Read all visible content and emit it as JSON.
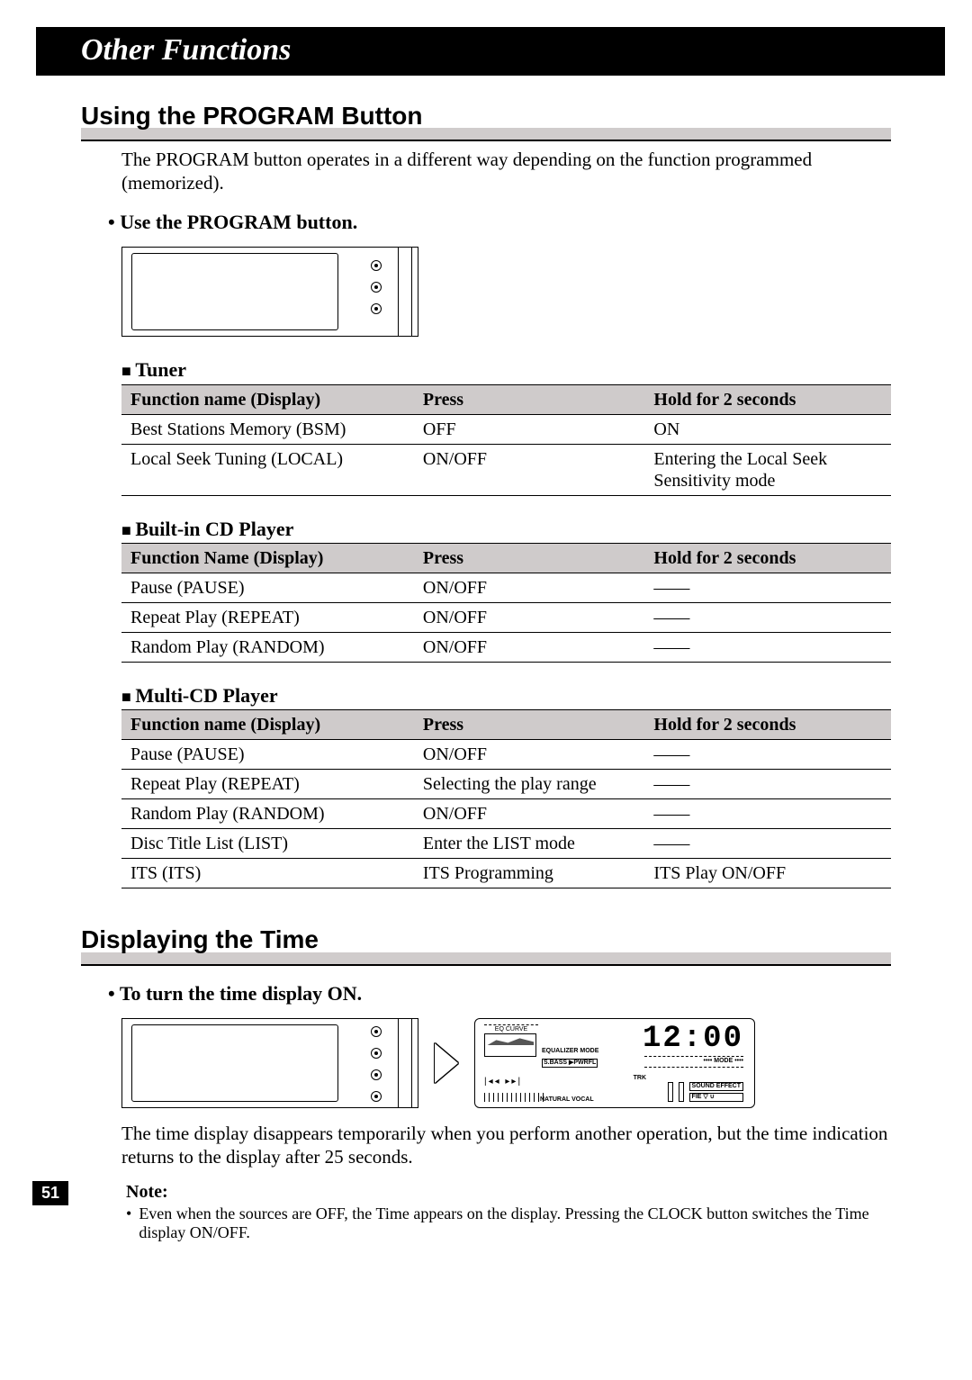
{
  "banner": "Other Functions",
  "section1": {
    "heading": "Using the PROGRAM Button",
    "intro": "The PROGRAM button operates in a different way depending on the function programmed (memorized).",
    "bullet": "Use the PROGRAM button."
  },
  "tables": {
    "tuner": {
      "title": "Tuner",
      "headers": [
        "Function name (Display)",
        "Press",
        "Hold for 2 seconds"
      ],
      "rows": [
        [
          "Best Stations Memory (BSM)",
          "OFF",
          "ON"
        ],
        [
          "Local Seek Tuning (LOCAL)",
          "ON/OFF",
          "Entering the Local Seek Sensitivity mode"
        ]
      ]
    },
    "cd": {
      "title": "Built-in CD Player",
      "headers": [
        "Function Name (Display)",
        "Press",
        "Hold for 2 seconds"
      ],
      "rows": [
        [
          "Pause (PAUSE)",
          "ON/OFF",
          "——"
        ],
        [
          "Repeat Play (REPEAT)",
          "ON/OFF",
          "——"
        ],
        [
          "Random Play (RANDOM)",
          "ON/OFF",
          "——"
        ]
      ]
    },
    "multi": {
      "title": "Multi-CD Player",
      "headers": [
        "Function name (Display)",
        "Press",
        "Hold for 2 seconds"
      ],
      "rows": [
        [
          "Pause (PAUSE)",
          "ON/OFF",
          "——"
        ],
        [
          "Repeat Play (REPEAT)",
          "Selecting the play range",
          "——"
        ],
        [
          "Random Play (RANDOM)",
          "ON/OFF",
          "——"
        ],
        [
          "Disc Title List (LIST)",
          "Enter the LIST mode",
          "——"
        ],
        [
          "ITS (ITS)",
          "ITS Programming",
          "ITS Play ON/OFF"
        ]
      ]
    }
  },
  "section2": {
    "heading": "Displaying the Time",
    "bullet": "To turn the time display ON.",
    "body": "The time display disappears temporarily when you perform another operation, but the time indication returns to the display after 25 seconds.",
    "note_label": "Note:",
    "note_text": "Even when the sources are OFF, the Time appears on the display. Pressing the CLOCK button switches the Time display ON/OFF."
  },
  "lcd": {
    "eq_curve": "EQ CURVE",
    "equalizer_mode": "EQUALIZER MODE",
    "sbass": "S.BASS ▶PWRFL",
    "natural_vocal": "NATURAL  VOCAL",
    "prev_next": "|◂◂   ▸▸|",
    "time": "12:00",
    "mode": "•••• MODE ••••",
    "trk": "TRK",
    "sound_effect": "SOUND EFFECT",
    "fie": "FIE ▽ ∪"
  },
  "page_number": "51"
}
